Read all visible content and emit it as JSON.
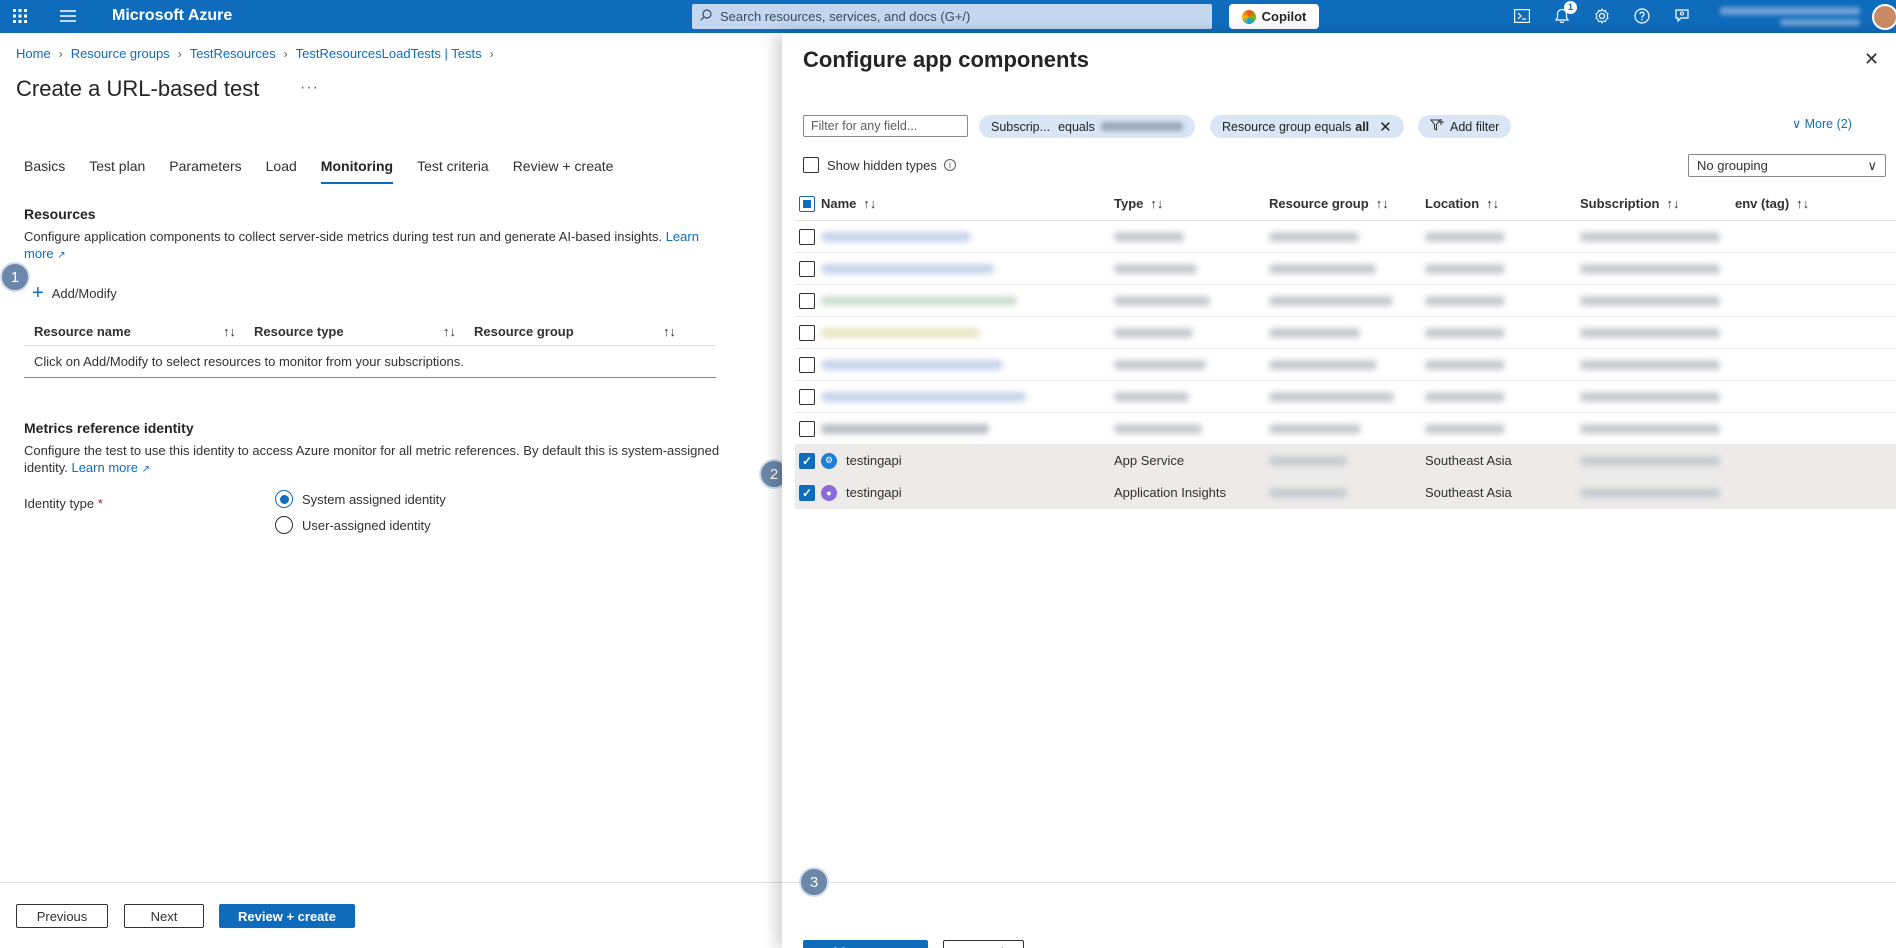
{
  "topbar": {
    "brand": "Microsoft Azure",
    "search_placeholder": "Search resources, services, and docs (G+/)",
    "copilot_label": "Copilot",
    "notification_count": "1"
  },
  "breadcrumb": [
    "Home",
    "Resource groups",
    "TestResources",
    "TestResourcesLoadTests | Tests"
  ],
  "page_title": "Create a URL-based test",
  "more_glyph": "···",
  "tabs": [
    "Basics",
    "Test plan",
    "Parameters",
    "Load",
    "Monitoring",
    "Test criteria",
    "Review + create"
  ],
  "active_tab": "Monitoring",
  "resources": {
    "title": "Resources",
    "description": "Configure application components to collect server-side metrics during test run and generate AI-based insights.",
    "learn_more": "Learn more",
    "add_modify": "Add/Modify",
    "columns": [
      "Resource name",
      "Resource type",
      "Resource group"
    ],
    "empty_text": "Click on Add/Modify to select resources to monitor from your subscriptions."
  },
  "metrics": {
    "title": "Metrics reference identity",
    "description": "Configure the test to use this identity to access Azure monitor for all metric references. By default this is system-assigned identity.",
    "learn_more": "Learn more",
    "identity_label": "Identity type",
    "required_mark": "*",
    "options": [
      "System assigned identity",
      "User-assigned identity"
    ],
    "selected_option": "System assigned identity"
  },
  "left_footer": {
    "previous": "Previous",
    "next": "Next",
    "review": "Review + create"
  },
  "steps": [
    "1",
    "2",
    "3"
  ],
  "panel": {
    "title": "Configure app components",
    "filter_placeholder": "Filter for any field...",
    "subscription_pill_prefix": "Subscrip...",
    "subscription_pill_op": "equals",
    "rg_pill_prefix": "Resource group equals",
    "rg_pill_value": "all",
    "add_filter": "Add filter",
    "more_filters": "More (2)",
    "show_hidden": "Show hidden types",
    "grouping": "No grouping",
    "columns": [
      "Name",
      "Type",
      "Resource group",
      "Location",
      "Subscription",
      "env (tag)"
    ],
    "rows": [
      {
        "name": "testingapi",
        "type": "App Service",
        "location": "Southeast Asia",
        "icon": "app-service-icon"
      },
      {
        "name": "testingapi",
        "type": "Application Insights",
        "location": "Southeast Asia",
        "icon": "application-insights-icon"
      }
    ],
    "add_resources": "Add resources",
    "cancel": "Cancel"
  },
  "colors": {
    "accent": "#0f6cbd",
    "step_badge": "#6b87a9",
    "selected_row": "#edebe9"
  }
}
